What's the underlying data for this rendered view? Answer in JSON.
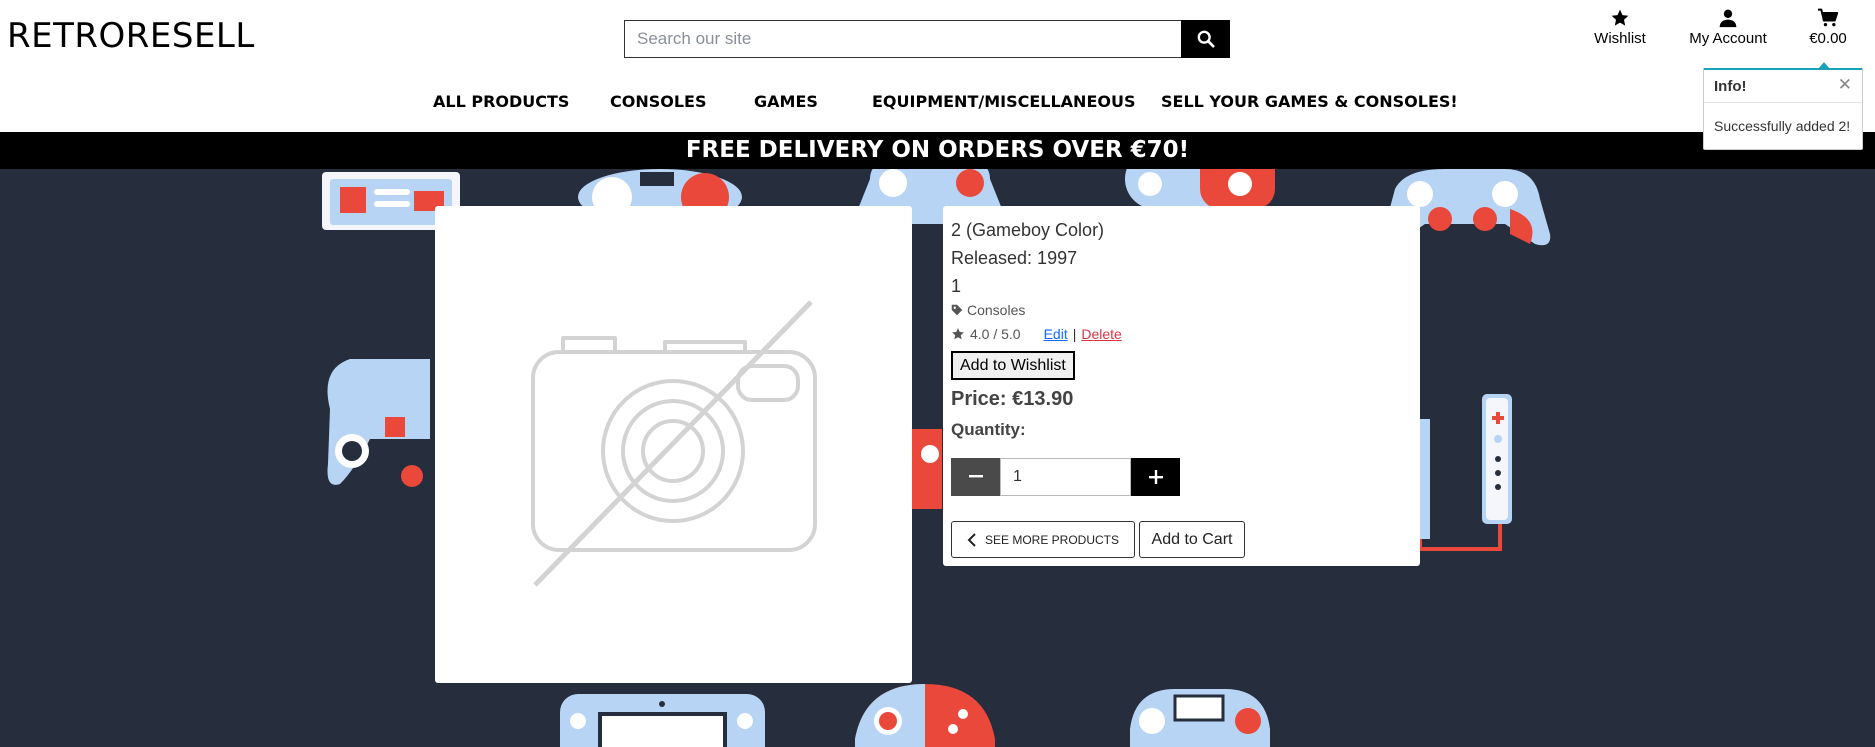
{
  "header": {
    "logo": "RETRORESELL",
    "search": {
      "placeholder": "Search our site",
      "value": ""
    },
    "wishlist_label": "Wishlist",
    "account_label": "My Account",
    "cart_total": "€0.00"
  },
  "nav": {
    "items": [
      "ALL PRODUCTS",
      "CONSOLES",
      "GAMES",
      "EQUIPMENT/MISCELLANEOUS",
      "SELL YOUR GAMES & CONSOLES!"
    ]
  },
  "banner": {
    "text": "FREE DELIVERY ON ORDERS OVER €70!"
  },
  "product": {
    "name": "2 (Gameboy Color)",
    "released": "Released: 1997",
    "description": "1",
    "category": "Consoles",
    "rating": "4.0 / 5.0",
    "edit_label": "Edit",
    "separator": "|",
    "delete_label": "Delete",
    "wishlist_button": "Add to Wishlist",
    "price": "Price: €13.90",
    "quantity_label": "Quantity:",
    "quantity_value": "1",
    "see_more_label": "SEE MORE PRODUCTS",
    "add_to_cart_label": "Add to Cart"
  },
  "toast": {
    "title": "Info!",
    "message": "Successfully added 2!"
  },
  "icons": {
    "search": "search-icon",
    "wishlist": "star-icon",
    "account": "user-icon",
    "cart": "cart-icon",
    "tag": "tag-icon",
    "rating": "star-icon",
    "no_image": "no-image-icon",
    "back": "chevron-left-icon",
    "close": "close-icon"
  },
  "colors": {
    "background": "#262e3d",
    "banner": "#000000",
    "edit_link": "#0d6efd",
    "delete_link": "#dc3545",
    "toast_accent": "#17a2b8",
    "controller_red": "#e9483b",
    "controller_blue": "#b8d4f5"
  }
}
